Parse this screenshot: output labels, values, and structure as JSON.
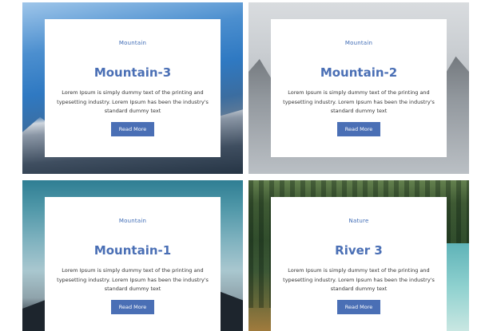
{
  "cards": [
    {
      "category": "Mountain",
      "title": "Mountain-3",
      "description": "Lorem Ipsum is simply dummy text of the printing and typesetting industry. Lorem Ipsum has been the industry's standard dummy text",
      "button_label": "Read More"
    },
    {
      "category": "Mountain",
      "title": "Mountain-2",
      "description": "Lorem Ipsum is simply dummy text of the printing and typesetting industry. Lorem Ipsum has been the industry's standard dummy text",
      "button_label": "Read More"
    },
    {
      "category": "Mountain",
      "title": "Mountain-1",
      "description": "Lorem Ipsum is simply dummy text of the printing and typesetting industry. Lorem Ipsum has been the industry's standard dummy text",
      "button_label": "Read More"
    },
    {
      "category": "Nature",
      "title": "River 3",
      "description": "Lorem Ipsum is simply dummy text of the printing and typesetting industry. Lorem Ipsum has been the industry's standard dummy text",
      "button_label": "Read More"
    }
  ],
  "colors": {
    "accent": "#4a6fb5",
    "text": "#333333",
    "panel": "#ffffff"
  }
}
